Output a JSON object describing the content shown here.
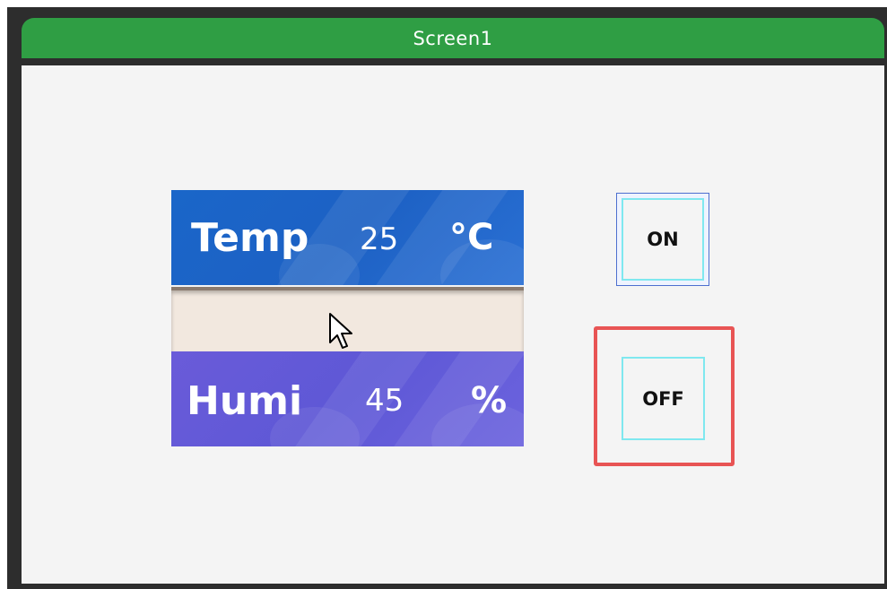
{
  "window": {
    "title": "Screen1"
  },
  "temp_panel": {
    "label": "Temp",
    "value": "25",
    "unit": "°C"
  },
  "humi_panel": {
    "label": "Humi",
    "value": "45",
    "unit": "%"
  },
  "buttons": {
    "on_label": "ON",
    "off_label": "OFF"
  },
  "colors": {
    "titlebar": "#2f9e44",
    "temp_panel": "#1d61c4",
    "humi_panel": "#5e58d6",
    "selection": "#e85454",
    "button_border": "#7fe8ef"
  },
  "icons": {
    "cursor": "mouse-pointer-icon"
  }
}
